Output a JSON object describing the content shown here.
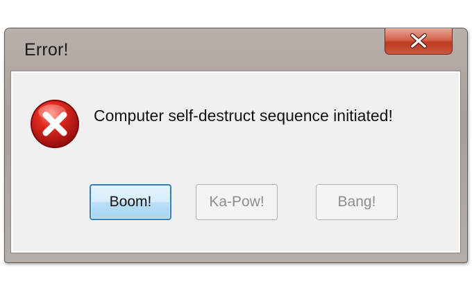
{
  "window": {
    "title": "Error!"
  },
  "dialog": {
    "message": "Computer self-destruct sequence initiated!",
    "icon": "error-icon"
  },
  "buttons": {
    "boom": "Boom!",
    "kapow": "Ka-Pow!",
    "bang": "Bang!"
  },
  "colors": {
    "close_button": "#c9482f",
    "error_icon": "#d11a1a",
    "default_button_border": "#3c7fb1",
    "disabled_text": "#8d8d8d"
  }
}
